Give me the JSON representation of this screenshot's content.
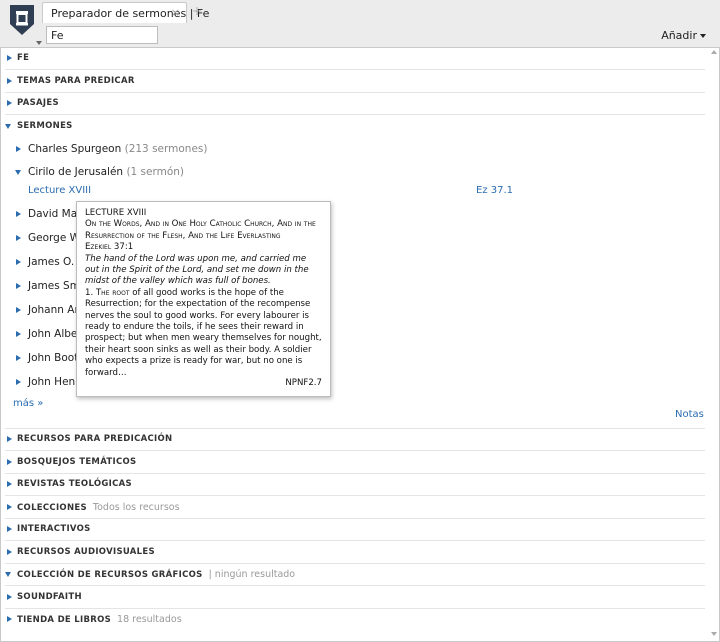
{
  "header": {
    "tab_title": "Preparador de sermones | Fe",
    "tab_close": "×",
    "tab_new": "+",
    "search_value": "Fe",
    "add_label": "Añadir"
  },
  "sections": {
    "fe": "FE",
    "temas": "TEMAS PARA PREDICAR",
    "pasajes": "PASAJES",
    "sermones": "SERMONES",
    "recursos": "RECURSOS PARA PREDICACIÓN",
    "bosquejos": "BOSQUEJOS TEMÁTICOS",
    "revistas": "REVISTAS TEOLÓGICAS",
    "colecciones": "COLECCIONES",
    "colecciones_note": "Todos los recursos",
    "interactivos": "INTERACTIVOS",
    "audiovisuales": "RECURSOS AUDIOVISUALES",
    "graficos": "COLECCIÓN DE RECURSOS GRÁFICOS",
    "graficos_note": "| ningún resultado",
    "soundfaith": "SOUNDFAITH",
    "tienda": "TIENDA DE LIBROS",
    "tienda_note": "18 resultados"
  },
  "sermons": {
    "spurgeon": "Charles Spurgeon",
    "spurgeon_count": "(213 sermones)",
    "cirilo": "Cirilo de Jerusalén",
    "cirilo_count": "(1 sermón)",
    "lecture": "Lecture XVIII",
    "lecture_ref": "Ez 37.1",
    "david": "David Marty",
    "george": "George Whit",
    "jamesm": "James O. Mu",
    "jamess": "James Smit",
    "johann": "Johann Arnd",
    "johnalbert": "John Albert",
    "johnbooty": "John Booty",
    "johnhenry": "John Henry",
    "more": "más »",
    "notes": "Notas"
  },
  "popup": {
    "title": "LECTURE XVIII",
    "heading": "On the Words, And in One Holy Catholic Church, And in the Resurrection of the Flesh, And the Life Everlasting",
    "ref": "Ezekiel 37:1",
    "quote": "The hand of the Lord was upon me, and carried me out in the Spirit of the Lord, and set me down in the midst of the valley which was full of bones.",
    "body_num": "1.",
    "body_first": "The root",
    "body_rest": "of all good works is the hope of the Resurrection; for the expectation of the recompense nerves the soul to good works. For every labourer is ready to endure the toils, if he sees their reward in prospect; but when men weary themselves for nought, their heart soon sinks as well as their body. A soldier who expects a prize is ready for war, but no one is forward…",
    "source": "NPNF2.7"
  }
}
